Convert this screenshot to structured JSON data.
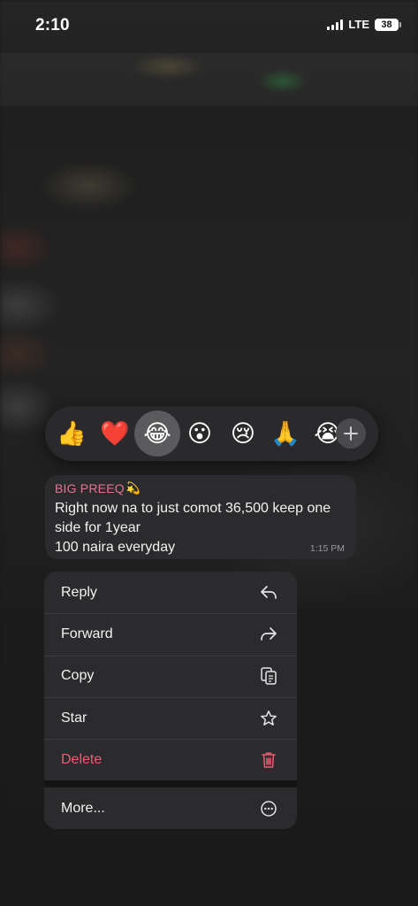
{
  "status_bar": {
    "time": "2:10",
    "network": "LTE",
    "battery": "38"
  },
  "reactions": {
    "items": [
      {
        "emoji": "👍",
        "name": "thumbs-up"
      },
      {
        "emoji": "❤️",
        "name": "heart"
      },
      {
        "emoji": "😂",
        "name": "tears-of-joy"
      },
      {
        "emoji": "😮",
        "name": "surprised"
      },
      {
        "emoji": "😢",
        "name": "crying"
      },
      {
        "emoji": "🙏",
        "name": "folded-hands"
      },
      {
        "emoji": "😭",
        "name": "loudly-crying"
      }
    ],
    "selected_index": 2,
    "more_icon": "plus-icon"
  },
  "message": {
    "sender": "BIG PREEQ",
    "sender_emoji": "💫",
    "text": "Right now na to just comot 36,500 keep one side for 1year\n100 naira everyday",
    "time": "1:15 PM"
  },
  "menu": {
    "reply": {
      "label": "Reply",
      "icon": "reply-icon"
    },
    "forward": {
      "label": "Forward",
      "icon": "forward-icon"
    },
    "copy": {
      "label": "Copy",
      "icon": "copy-icon"
    },
    "star": {
      "label": "Star",
      "icon": "star-icon"
    },
    "delete": {
      "label": "Delete",
      "icon": "trash-icon"
    },
    "more": {
      "label": "More...",
      "icon": "ellipsis-icon"
    }
  },
  "colors": {
    "sender_name": "#e47396",
    "destructive": "#eb5d73",
    "surface": "#2b2b2d"
  }
}
